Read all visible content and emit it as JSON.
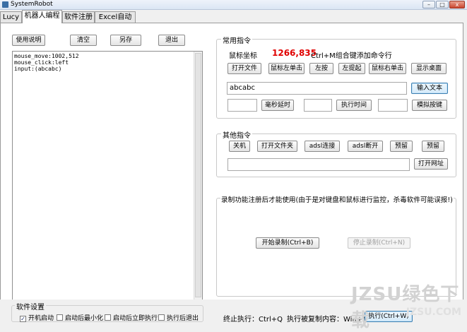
{
  "window": {
    "title": "SystemRobot",
    "controls": {
      "minimize": "–",
      "maximize": "□",
      "close": "x"
    }
  },
  "tabs": [
    {
      "label": "Lucy"
    },
    {
      "label": "机器人编程"
    },
    {
      "label": "软件注册"
    },
    {
      "label": "Excel自动化"
    }
  ],
  "editor": {
    "toolbar": {
      "help": "使用说明",
      "clear": "清空",
      "save_as": "另存",
      "exit": "退出"
    },
    "lines": [
      {
        "text": "mouse_move:1002,512"
      },
      {
        "text": "mouse_click:left"
      },
      {
        "text": "input:(abcabc)"
      }
    ]
  },
  "common_commands": {
    "title": "常用指令",
    "mouse_coord_label": "鼠标坐标",
    "mouse_coord_value": "1266,835",
    "shortcut_hint": "Ctrl+M组合键添加命令行",
    "buttons": {
      "open_file": "打开文件",
      "left_click": "鼠标左单击",
      "left_press": "左按",
      "left_lift": "左提起",
      "right_click": "鼠标右单击",
      "show_desktop": "显示桌面"
    },
    "text_input_value": "abcabc",
    "input_text_button": "输入文本",
    "delay_value": "",
    "delay_button": "毫秒延时",
    "exec_time_value": "",
    "exec_time_button": "执行时间",
    "key_value": "",
    "simulate_key_button": "模拟按键"
  },
  "other_commands": {
    "title": "其他指令",
    "buttons": {
      "shutdown": "关机",
      "open_folder": "打开文件夹",
      "adsl_connect": "adsl连接",
      "adsl_disconnect": "adsl断开",
      "reserved1": "预留",
      "reserved2": "预留"
    },
    "url_value": "",
    "open_url_button": "打开网址"
  },
  "record": {
    "notice": "录制功能注册后才能使用(由于是对键盘和鼠标进行监控，杀毒软件可能误报!)",
    "start_button": "开始录制(Ctrl+B)",
    "stop_button": "停止录制(Ctrl+N)"
  },
  "settings": {
    "title": "软件设置",
    "options": [
      {
        "label": "开机启动",
        "checked": true
      },
      {
        "label": "启动后最小化",
        "checked": false
      },
      {
        "label": "启动后立即执行",
        "checked": false
      },
      {
        "label": "执行后退出",
        "checked": false
      }
    ]
  },
  "status": {
    "stop_exec": "终止执行：Ctrl+Q",
    "exec_copied": "执行被复制内容：Win+A",
    "exec_button": "执行(Ctrl+W)"
  },
  "watermark": {
    "big": "JZSU绿色下载",
    "small": "JZSU.COM"
  }
}
